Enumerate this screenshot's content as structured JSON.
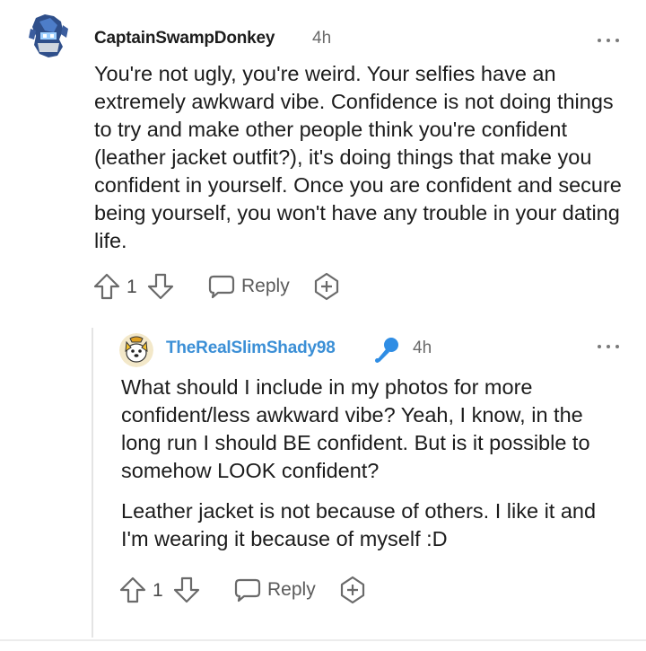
{
  "comments": [
    {
      "username": "CaptainSwampDonkey",
      "time": "4h",
      "body": "You're not ugly, you're weird. Your selfies have an extremely awkward vibe. Confidence is not doing things to try and make other people think you're confident (leather jacket outfit?), it's doing things that make you confident in yourself. Once you are confident and secure being yourself, you won't have any trouble in your dating life.",
      "score": "1",
      "reply_label": "Reply"
    },
    {
      "username": "TheRealSlimShady98",
      "time": "4h",
      "body_p1": "What should I include in my photos for more confident/less awkward vibe? Yeah, I know, in the long run I should BE confident. But is it possible to somehow LOOK confident?",
      "body_p2": "Leather jacket is not because of others. I like it and I'm wearing it because of myself :D",
      "score": "1",
      "reply_label": "Reply"
    }
  ],
  "icons": {
    "avatar1": "robot-avatar-icon",
    "avatar2": "dog-avatar-icon",
    "flair": "microphone-icon",
    "more": "more-options-icon",
    "upvote": "upvote-arrow-icon",
    "downvote": "downvote-arrow-icon",
    "reply": "reply-bubble-icon",
    "award": "award-icon"
  },
  "colors": {
    "username_op": "#1c1c1c",
    "username_reply": "#3b8fd6",
    "mic": "#2f8de4"
  }
}
